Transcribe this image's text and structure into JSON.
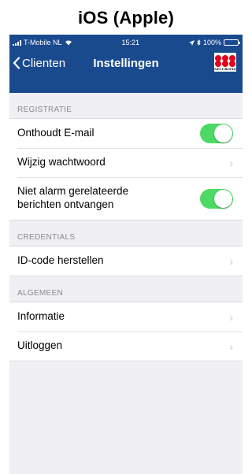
{
  "caption": "iOS (Apple)",
  "status_bar": {
    "carrier": "T-Mobile NL",
    "time": "15:21",
    "battery": "100%"
  },
  "navbar": {
    "back_label": "Clienten",
    "title": "Instellingen",
    "logo_text": "SECURITAS"
  },
  "sections": {
    "registratie": {
      "header": "REGISTRATIE",
      "email_label": "Onthoudt E-mail",
      "password_label": "Wijzig wachtwoord",
      "alarm_label_line1": "Niet alarm gerelateerde",
      "alarm_label_line2": "berichten ontvangen"
    },
    "credentials": {
      "header": "CREDENTIALS",
      "idcode_label": "ID-code herstellen"
    },
    "algemeen": {
      "header": "ALGEMEEN",
      "info_label": "Informatie",
      "logout_label": "Uitloggen"
    }
  },
  "toggles": {
    "remember_email": true,
    "non_alarm_messages": true
  },
  "colors": {
    "navbar": "#1a4a8e",
    "toggle_on": "#4cd964",
    "background": "#efeff4",
    "logo_red": "#e3001b"
  },
  "icons": {
    "back": "chevron-left-icon",
    "disclosure": "chevron-right-icon",
    "wifi": "wifi-icon",
    "bluetooth": "bluetooth-icon",
    "location": "location-icon",
    "battery": "battery-icon"
  }
}
